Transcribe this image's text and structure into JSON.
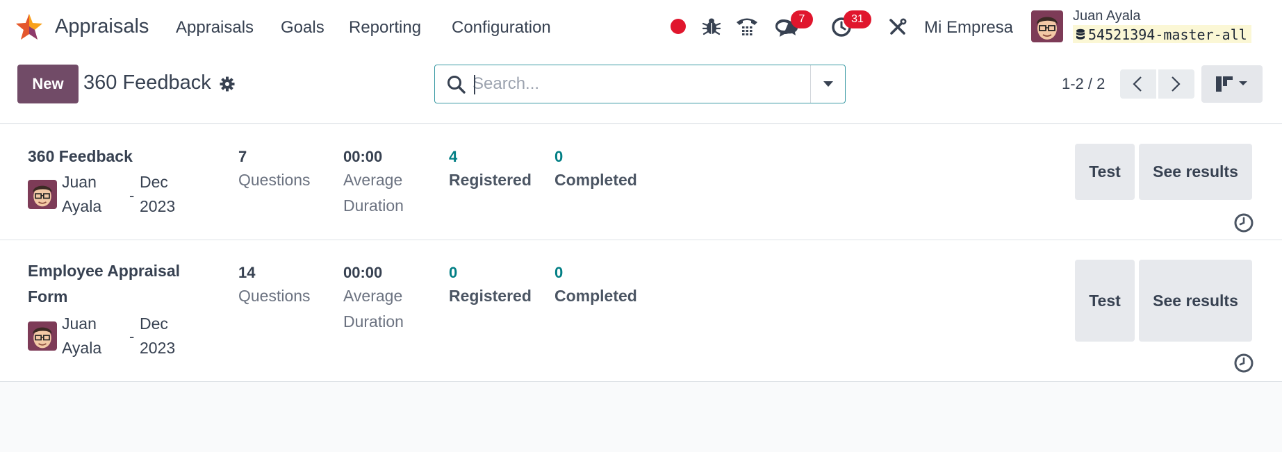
{
  "navbar": {
    "app_name": "Appraisals",
    "menu": [
      "Appraisals",
      "Goals",
      "Reporting",
      "Configuration"
    ],
    "messages_count": "7",
    "activities_count": "31",
    "company": "Mi Empresa",
    "user_name": "Juan Ayala",
    "database": "54521394-master-all",
    "icons": [
      "recording-dot-icon",
      "bug-icon",
      "phone-icon",
      "chat-icon",
      "clock-icon",
      "tools-icon"
    ],
    "colors": {
      "brand": "#714b67",
      "badge": "#e0162d",
      "record_dot": "#e0162d"
    }
  },
  "control": {
    "new_label": "New",
    "title": "360 Feedback",
    "search_placeholder": "Search...",
    "pager": "1-2 / 2"
  },
  "records": [
    {
      "title_lines": [
        "360 Feedback"
      ],
      "user_lines": [
        "Juan",
        "Ayala"
      ],
      "dash": "-",
      "date_lines": [
        "Dec",
        "2023"
      ],
      "questions_value": "7",
      "questions_label": "Questions",
      "duration_value": "00:00",
      "duration_lines": [
        "Average",
        "Duration"
      ],
      "registered_value": "4",
      "registered_label": "Registered",
      "completed_value": "0",
      "completed_label": "Completed",
      "test_label": "Test",
      "results_label": "See results"
    },
    {
      "title_lines": [
        "Employee Appraisal",
        "Form"
      ],
      "user_lines": [
        "Juan",
        "Ayala"
      ],
      "dash": "-",
      "date_lines": [
        "Dec",
        "2023"
      ],
      "questions_value": "14",
      "questions_label": "Questions",
      "duration_value": "00:00",
      "duration_lines": [
        "Average",
        "Duration"
      ],
      "registered_value": "0",
      "registered_label": "Registered",
      "completed_value": "0",
      "completed_label": "Completed",
      "test_label": "Test",
      "results_label": "See results"
    }
  ]
}
